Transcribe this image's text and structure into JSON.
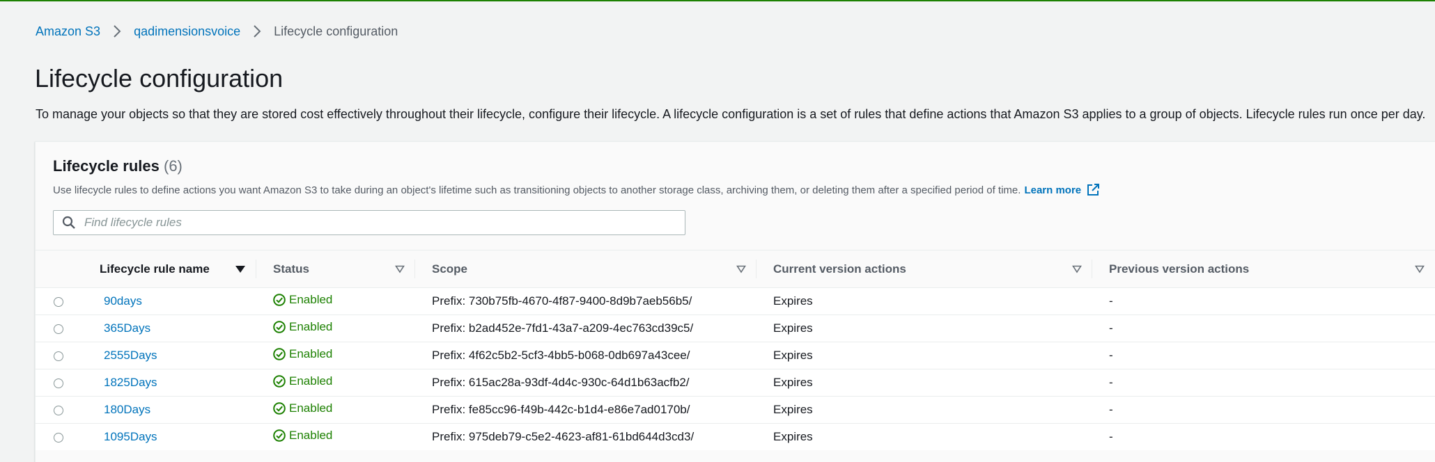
{
  "breadcrumb": {
    "items": [
      "Amazon S3",
      "qadimensionsvoice"
    ],
    "current": "Lifecycle configuration"
  },
  "page": {
    "title": "Lifecycle configuration",
    "description": "To manage your objects so that they are stored cost effectively throughout their lifecycle, configure their lifecycle. A lifecycle configuration is a set of rules that define actions that Amazon S3 applies to a group of objects. Lifecycle rules run once per day."
  },
  "panel": {
    "title": "Lifecycle rules",
    "count": "(6)",
    "description": "Use lifecycle rules to define actions you want Amazon S3 to take during an object's lifetime such as transitioning objects to another storage class, archiving them, or deleting them after a specified period of time.",
    "learn_more": "Learn more",
    "search_placeholder": "Find lifecycle rules"
  },
  "table": {
    "columns": [
      "Lifecycle rule name",
      "Status",
      "Scope",
      "Current version actions",
      "Previous version actions"
    ],
    "rows": [
      {
        "name": "90days",
        "status": "Enabled",
        "scope": "Prefix: 730b75fb-4670-4f87-9400-8d9b7aeb56b5/",
        "current": "Expires",
        "previous": "-"
      },
      {
        "name": "365Days",
        "status": "Enabled",
        "scope": "Prefix: b2ad452e-7fd1-43a7-a209-4ec763cd39c5/",
        "current": "Expires",
        "previous": "-"
      },
      {
        "name": "2555Days",
        "status": "Enabled",
        "scope": "Prefix: 4f62c5b2-5cf3-4bb5-b068-0db697a43cee/",
        "current": "Expires",
        "previous": "-"
      },
      {
        "name": "1825Days",
        "status": "Enabled",
        "scope": "Prefix: 615ac28a-93df-4d4c-930c-64d1b63acfb2/",
        "current": "Expires",
        "previous": "-"
      },
      {
        "name": "180Days",
        "status": "Enabled",
        "scope": "Prefix: fe85cc96-f49b-442c-b1d4-e86e7ad0170b/",
        "current": "Expires",
        "previous": "-"
      },
      {
        "name": "1095Days",
        "status": "Enabled",
        "scope": "Prefix: 975deb79-c5e2-4623-af81-61bd644d3cd3/",
        "current": "Expires",
        "previous": "-"
      }
    ]
  },
  "colors": {
    "link": "#0073bb",
    "success": "#1d8102",
    "text": "#16191f",
    "muted": "#545b64"
  },
  "icons": {
    "breadcrumb_separator": "chevron-right-icon",
    "external_link": "external-link-icon",
    "search": "search-icon",
    "sort_active": "caret-down-filled-icon",
    "sort_inactive": "caret-down-outline-icon",
    "status": "check-circle-icon"
  }
}
